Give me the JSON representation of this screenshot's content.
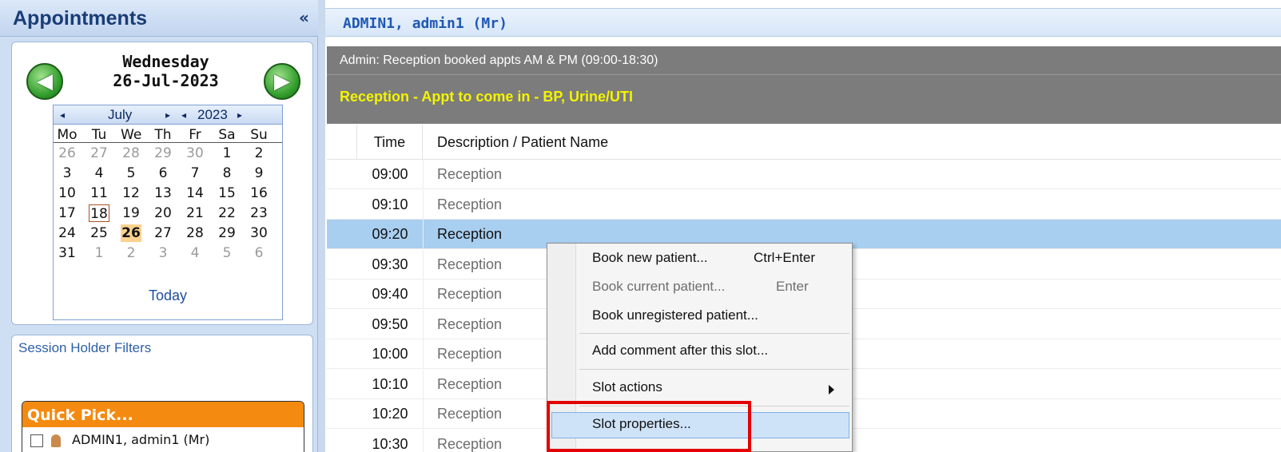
{
  "left_panel": {
    "title": "Appointments",
    "collapse_glyph": "«",
    "date_weekday": "Wednesday",
    "date_full": "26-Jul-2023",
    "calendar": {
      "month": "July",
      "year": "2023",
      "weekdays": [
        "Mo",
        "Tu",
        "We",
        "Th",
        "Fr",
        "Sa",
        "Su"
      ],
      "weeks": [
        [
          "26",
          "27",
          "28",
          "29",
          "30",
          "1",
          "2"
        ],
        [
          "3",
          "4",
          "5",
          "6",
          "7",
          "8",
          "9"
        ],
        [
          "10",
          "11",
          "12",
          "13",
          "14",
          "15",
          "16"
        ],
        [
          "17",
          "18",
          "19",
          "20",
          "21",
          "22",
          "23"
        ],
        [
          "24",
          "25",
          "26",
          "27",
          "28",
          "29",
          "30"
        ],
        [
          "31",
          "1",
          "2",
          "3",
          "4",
          "5",
          "6"
        ]
      ],
      "today_label": "Today"
    },
    "filters_label": "Session Holder Filters",
    "quick_pick": {
      "title": "Quick Pick...",
      "item": "ADMIN1, admin1 (Mr)"
    }
  },
  "right_panel": {
    "title": "ADMIN1, admin1 (Mr)",
    "session_header": "Admin: Reception booked appts AM & PM (09:00-18:30)",
    "session_subheader": "Reception - Appt to come in - BP, Urine/UTI",
    "columns": {
      "time": "Time",
      "description": "Description / Patient Name"
    },
    "rows": [
      {
        "time": "09:00",
        "desc": "Reception"
      },
      {
        "time": "09:10",
        "desc": "Reception"
      },
      {
        "time": "09:20",
        "desc": "Reception"
      },
      {
        "time": "09:30",
        "desc": "Reception"
      },
      {
        "time": "09:40",
        "desc": "Reception"
      },
      {
        "time": "09:50",
        "desc": "Reception"
      },
      {
        "time": "10:00",
        "desc": "Reception"
      },
      {
        "time": "10:10",
        "desc": "Reception"
      },
      {
        "time": "10:20",
        "desc": "Reception"
      },
      {
        "time": "10:30",
        "desc": "Reception"
      }
    ],
    "selected_row_time": "09:20"
  },
  "context_menu": {
    "items": [
      {
        "label": "Book new patient...",
        "shortcut": "Ctrl+Enter"
      },
      {
        "label": "Book current patient...",
        "shortcut": "Enter"
      },
      {
        "label": "Book unregistered patient..."
      },
      {
        "label": "Add comment after this slot..."
      },
      {
        "label": "Slot actions"
      },
      {
        "label": "Slot properties..."
      }
    ]
  },
  "colors": {
    "accent_blue": "#1f58b4",
    "selected_row": "#a8cef0",
    "session_bg": "#7c7c7c",
    "session_highlight_text": "#f4f400",
    "quick_pick_orange": "#f48a0f",
    "annotation_red": "#e30000"
  }
}
